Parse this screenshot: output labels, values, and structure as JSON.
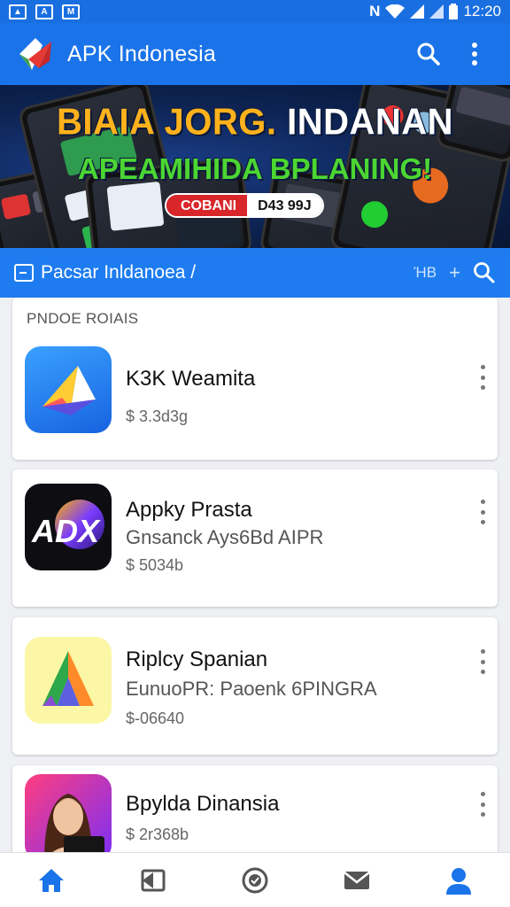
{
  "status_bar": {
    "time": "12:20",
    "left_icons": [
      "image-notification-icon",
      "a-notification-icon",
      "mail-notification-icon"
    ],
    "right_icons": [
      "nfc-icon",
      "wifi-icon",
      "signal-icon",
      "signal-icon",
      "battery-icon"
    ]
  },
  "app_bar": {
    "title": "APK Indonesia",
    "actions": [
      "search-icon",
      "more-vert-icon"
    ]
  },
  "banner": {
    "line1_part1": "BIAIA JORG.",
    "line1_part2": " INDANAN",
    "line2": "APEAMIHIDA BPLANING!",
    "cta_left": "COBANI",
    "cta_right": "D43 99J"
  },
  "sub_bar": {
    "text": "Pacsar Inldanoea /",
    "tool1": "ΉΒ",
    "tool2": "+"
  },
  "section": {
    "label": "PNDOE ROIAIS"
  },
  "apps": [
    {
      "name": "K3K Weamita",
      "subtitle": "",
      "price": "$ 3.3d3g",
      "icon": "paper-plane-icon"
    },
    {
      "name": "Appky Prasta",
      "subtitle": "Gnsanck Ays6Bd AIPR",
      "price": "$ 5034b",
      "icon": "adx-icon"
    },
    {
      "name": "Riplcy Spanian",
      "subtitle": "EunuoPR: Paoenk 6PINGRA",
      "price": "$-06640",
      "icon": "a-triangle-icon"
    },
    {
      "name": "Bpylda Dinansia",
      "subtitle": "",
      "price": "$ 2r368b",
      "icon": "woman-portrait-icon"
    }
  ],
  "bottom_nav": [
    "home-icon",
    "inbox-icon",
    "check-circle-icon",
    "mail-icon",
    "profile-icon"
  ],
  "colors": {
    "primary": "#1a73e8",
    "sub_bar": "#1e7cf0",
    "banner_yellow": "#ffb21c",
    "banner_green": "#4cd632",
    "cta_red": "#d8262b"
  }
}
